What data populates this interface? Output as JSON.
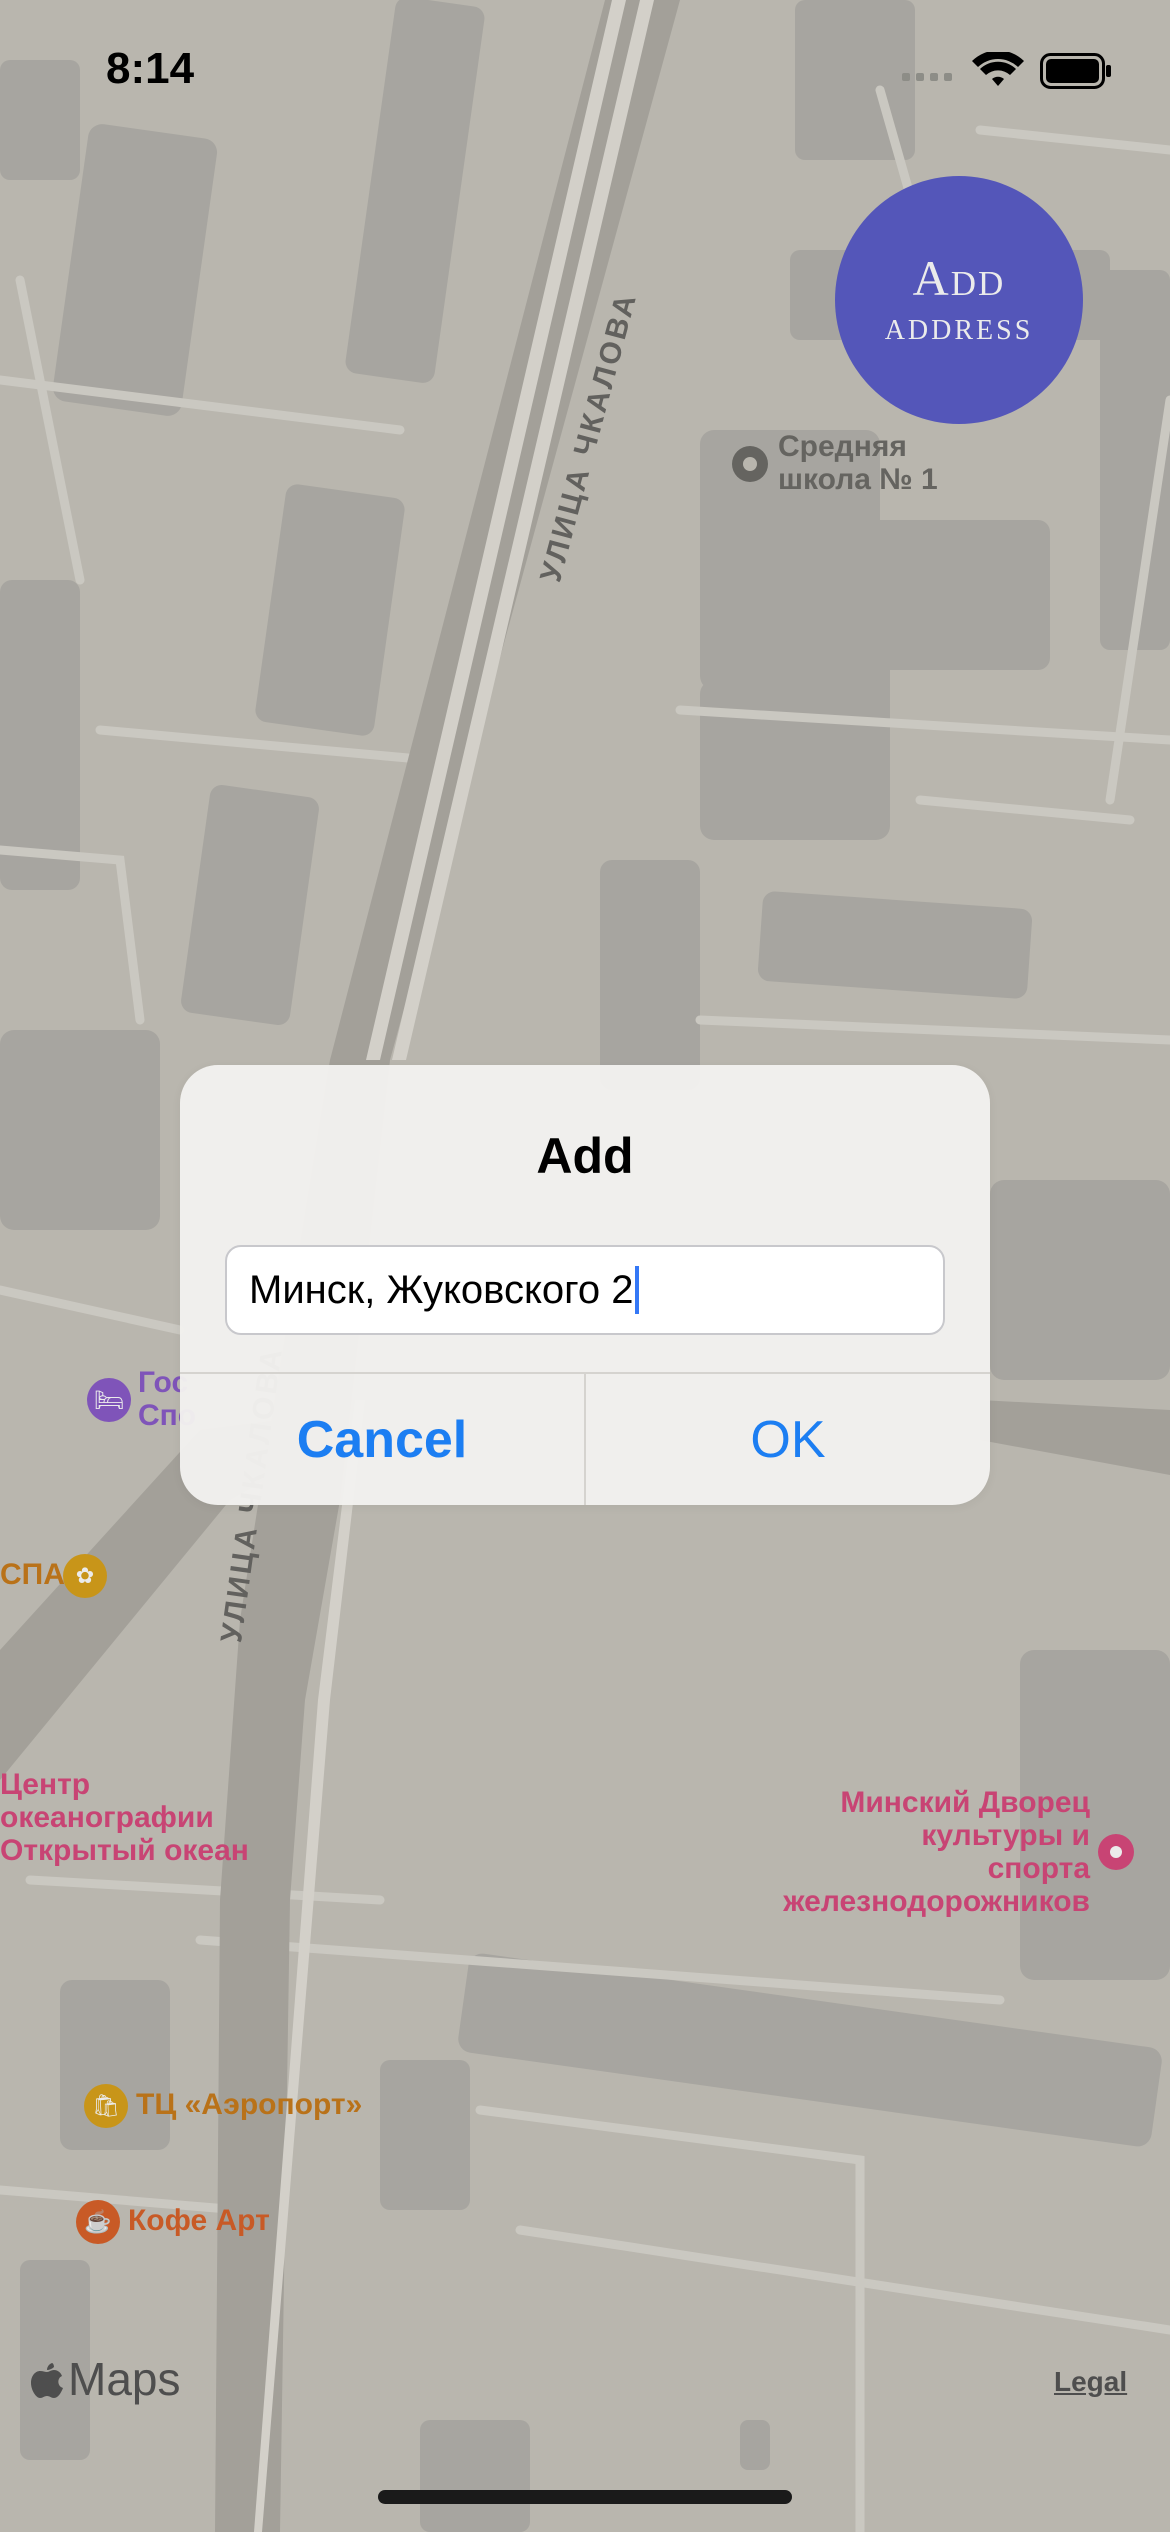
{
  "status_bar": {
    "time": "8:14"
  },
  "map": {
    "streets": [
      "УЛИЦА ЧКАЛОВА",
      "УЛИЦА ЧКАЛОВА"
    ],
    "pois": [
      {
        "id": "school",
        "lines": [
          "Средняя",
          "школа № 1"
        ],
        "color": "#6e6d69"
      },
      {
        "id": "hotel",
        "lines": [
          "Гос",
          "Спо"
        ],
        "color": "#8a5cc9"
      },
      {
        "id": "spa",
        "lines": [
          "СПА"
        ],
        "color": "#c97c1c"
      },
      {
        "id": "oceanography",
        "lines": [
          "Центр",
          "океанографии",
          "Открытый океан"
        ],
        "color": "#d94a7e"
      },
      {
        "id": "palace",
        "lines": [
          "Минский Дворец",
          "культуры и",
          "спорта",
          "железнодорожников"
        ],
        "color": "#d94a7e"
      },
      {
        "id": "mall",
        "lines": [
          "ТЦ «Аэропорт»"
        ],
        "color": "#c97c1c"
      },
      {
        "id": "cafe",
        "lines": [
          "Кофе Арт"
        ],
        "color": "#d9622a"
      }
    ],
    "attribution": "Maps",
    "legal": "Legal"
  },
  "fab": {
    "line1": "Add",
    "line2": "address",
    "color": "#5c5ec9"
  },
  "alert": {
    "title": "Add",
    "input_value": "Минск, Жуковского 2",
    "cancel_label": "Cancel",
    "ok_label": "OK",
    "accent": "#1c7ef2"
  }
}
